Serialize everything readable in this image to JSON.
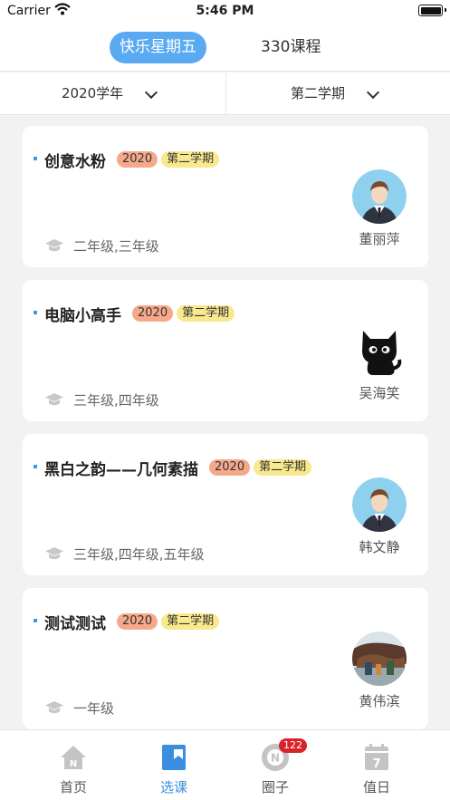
{
  "status_bar": {
    "carrier": "Carrier",
    "time": "5:46 PM"
  },
  "top_tabs": [
    {
      "label": "快乐星期五",
      "active": true
    },
    {
      "label": "330课程",
      "active": false
    }
  ],
  "filters": {
    "year": "2020学年",
    "term": "第二学期"
  },
  "courses": [
    {
      "title": "创意水粉",
      "year": "2020",
      "term": "第二学期",
      "grades": "二年级,三年级",
      "teacher": "董丽萍",
      "avatar": "man-avatar-icon"
    },
    {
      "title": "电脑小高手",
      "year": "2020",
      "term": "第二学期",
      "grades": "三年级,四年级",
      "teacher": "吴海笑",
      "avatar": "black-cat-avatar-icon"
    },
    {
      "title": "黑白之韵——几何素描",
      "year": "2020",
      "term": "第二学期",
      "grades": "三年级,四年级,五年级",
      "teacher": "韩文静",
      "avatar": "man-avatar-icon"
    },
    {
      "title": "测试测试",
      "year": "2020",
      "term": "第二学期",
      "grades": "一年级",
      "teacher": "黄伟滨",
      "avatar": "photo-avatar"
    }
  ],
  "tab_bar": [
    {
      "label": "首页",
      "icon": "home-icon",
      "active": false
    },
    {
      "label": "选课",
      "icon": "bookmark-icon",
      "active": true
    },
    {
      "label": "圈子",
      "icon": "circle-n-icon",
      "active": false,
      "badge": "122"
    },
    {
      "label": "值日",
      "icon": "calendar-7-icon",
      "active": false
    }
  ],
  "colors": {
    "accent": "#5aaaf2",
    "year_badge": "#f6a98a",
    "term_badge": "#f9e98e",
    "notification": "#d9232a"
  }
}
